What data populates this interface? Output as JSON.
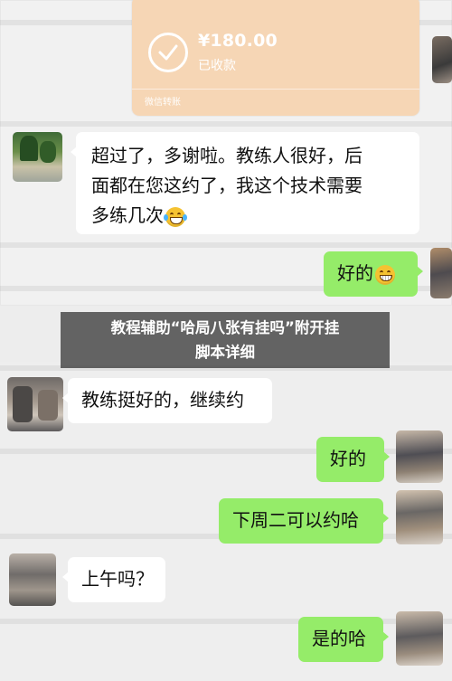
{
  "transfer": {
    "amount": "¥180.00",
    "status": "已收款",
    "label": "微信转账",
    "check_icon": "check-circle-icon",
    "color": "#f6d6b5"
  },
  "messages": [
    {
      "side": "left",
      "lines": [
        "超过了，多谢啦。教练人很好，后",
        "面都在您这约了，我这个技术需要",
        "多练几次"
      ],
      "emoji": "laughing-crying-emoji"
    },
    {
      "side": "right",
      "text": "好的",
      "emoji": "grinning-teeth-emoji"
    },
    {
      "side": "left",
      "text": "教练挺好的，继续约"
    },
    {
      "side": "right",
      "text": "好的"
    },
    {
      "side": "right",
      "text": "下周二可以约哈"
    },
    {
      "side": "left",
      "text": "上午吗？"
    },
    {
      "side": "right",
      "text": "是的哈"
    }
  ],
  "overlay": {
    "line1": "教程辅助“哈局八张有挂吗”附开挂",
    "line2": "脚本详细"
  },
  "colors": {
    "bubble_right": "#95ec69",
    "bubble_left": "#ffffff",
    "background": "#ededed"
  }
}
